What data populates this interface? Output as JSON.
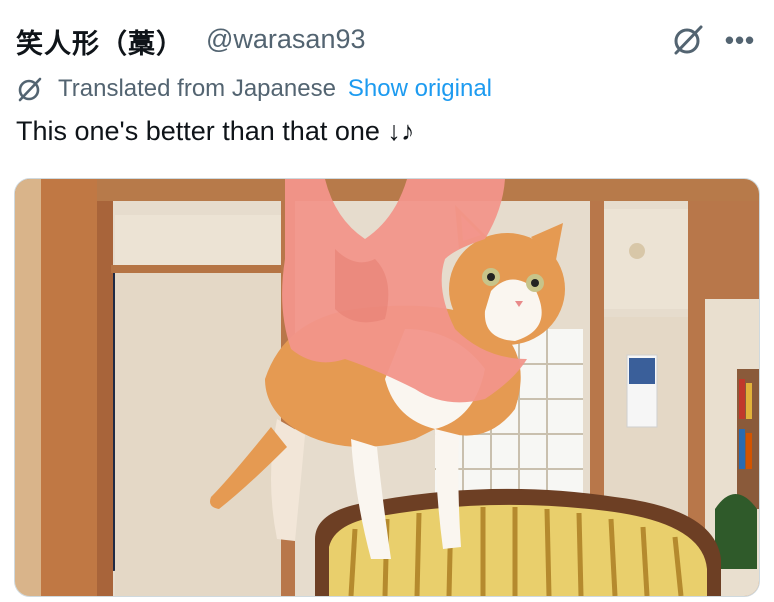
{
  "header": {
    "display_name": "笑人形（藁）",
    "handle": "@warasan93",
    "grok_icon": "grok-icon",
    "more_icon": "more-icon",
    "more_glyph": "•••"
  },
  "translation": {
    "icon": "translate-icon",
    "notice": "Translated from Japanese",
    "show_original": "Show original"
  },
  "tweet": {
    "text": "This one's better than that one ↓♪"
  },
  "media": {
    "type": "photo"
  }
}
